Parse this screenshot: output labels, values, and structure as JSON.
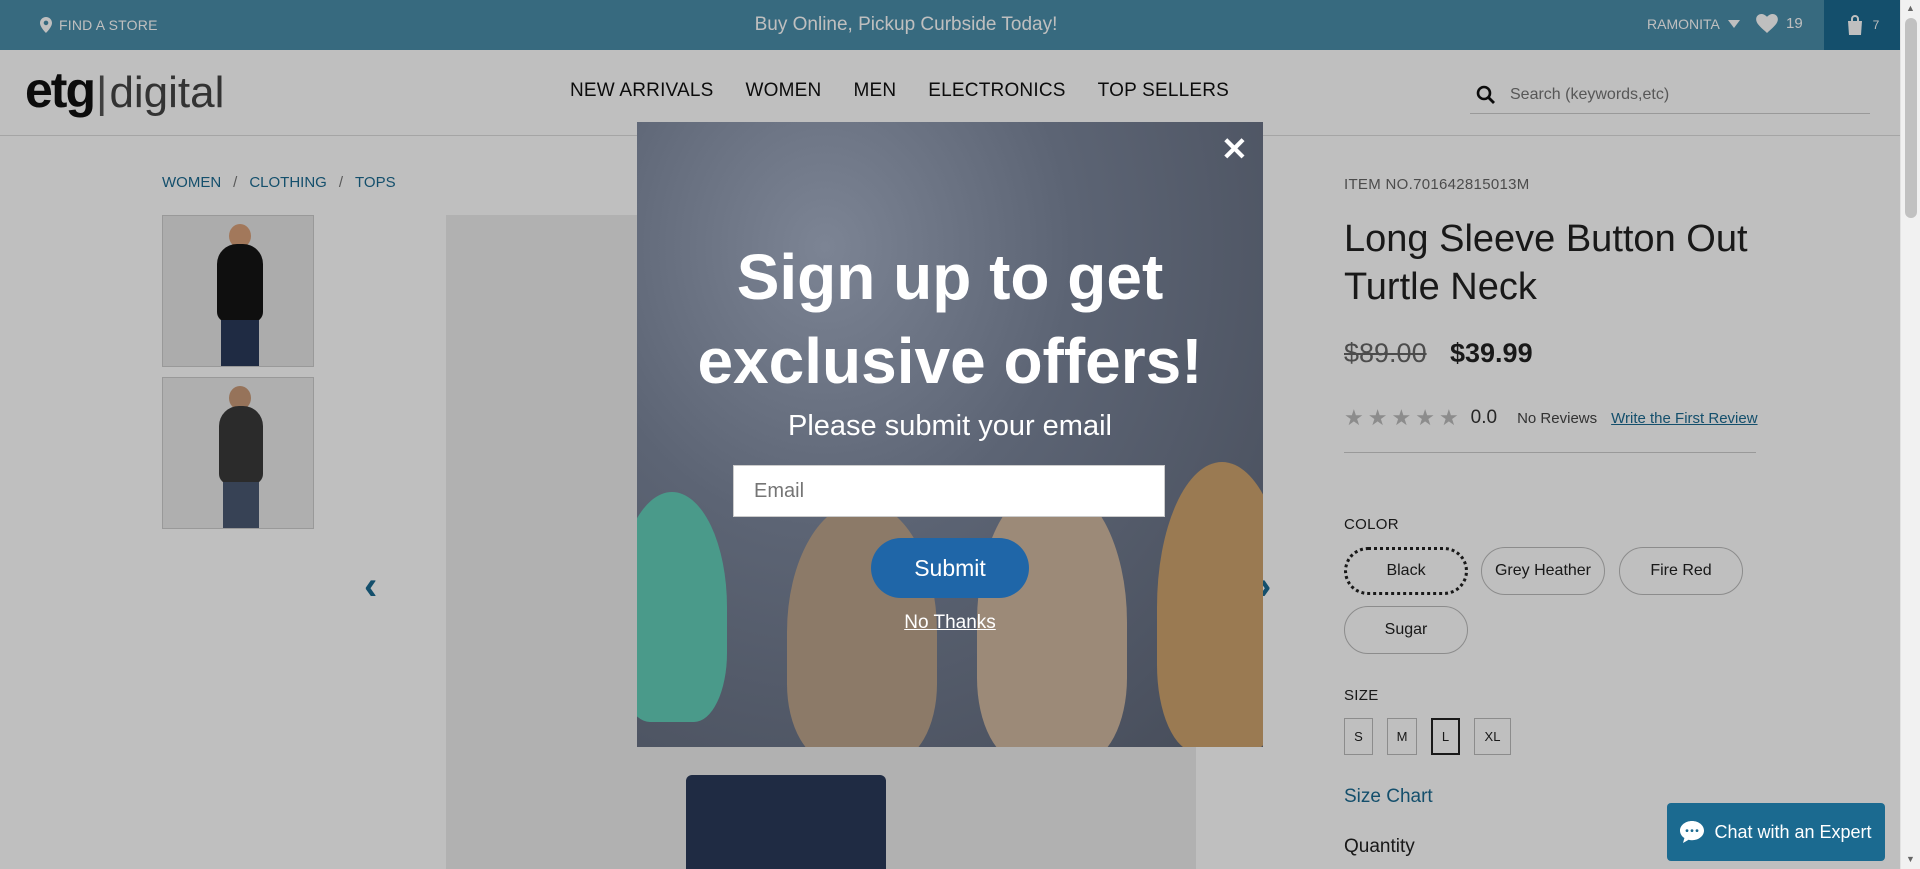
{
  "topbar": {
    "find_store": "FIND A STORE",
    "promo": "Buy Online, Pickup Curbside Today!",
    "user": "RAMONITA",
    "favorites_count": "19",
    "cart_count": "7"
  },
  "header": {
    "logo_etg": "etg",
    "logo_digital": "digital",
    "nav": [
      "NEW ARRIVALS",
      "WOMEN",
      "MEN",
      "ELECTRONICS",
      "TOP SELLERS"
    ],
    "search_placeholder": "Search (keywords,etc)"
  },
  "breadcrumb": [
    "WOMEN",
    "CLOTHING",
    "TOPS"
  ],
  "product": {
    "item_no": "ITEM NO.701642815013M",
    "title": "Long Sleeve Button Out Turtle Neck",
    "price_old": "$89.00",
    "price_new": "$39.99",
    "rating_score": "0.0",
    "rating_stars": 0,
    "no_reviews": "No Reviews",
    "write_review": "Write the First Review",
    "color_label": "COLOR",
    "colors": [
      "Black",
      "Grey Heather",
      "Fire Red",
      "Sugar"
    ],
    "selected_color": "Black",
    "size_label": "SIZE",
    "sizes": [
      "S",
      "M",
      "L",
      "XL"
    ],
    "selected_size": "L",
    "size_chart": "Size Chart",
    "quantity_label": "Quantity"
  },
  "modal": {
    "heading_line1": "Sign up to get",
    "heading_line2": "exclusive offers!",
    "subheading": "Please submit your email",
    "email_placeholder": "Email",
    "submit": "Submit",
    "no_thanks": "No Thanks"
  },
  "chat": {
    "label": "Chat with an Expert"
  }
}
